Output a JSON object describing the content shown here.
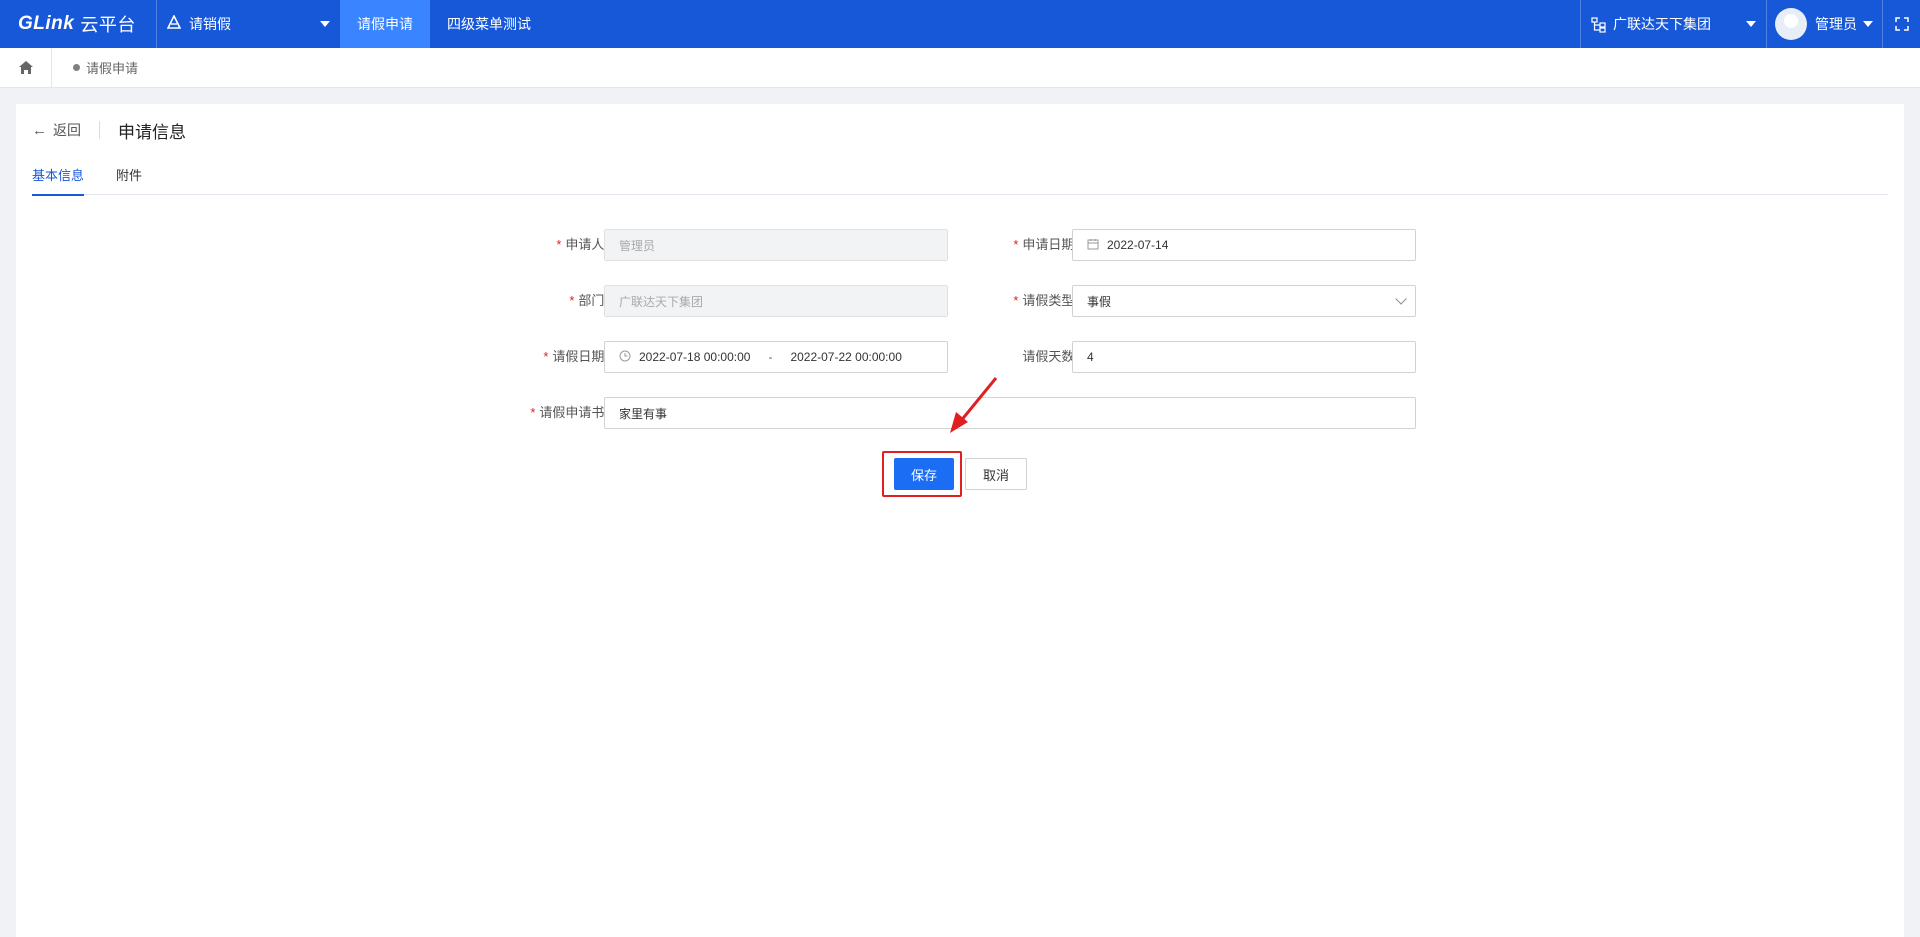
{
  "topbar": {
    "logo_text": "GLink",
    "logo_cn": "云平台",
    "app_name": "请销假",
    "menu": [
      {
        "label": "请假申请",
        "active": true
      },
      {
        "label": "四级菜单测试",
        "active": false
      }
    ],
    "org_name": "广联达天下集团",
    "user_name": "管理员"
  },
  "breadcrumb": {
    "current": "请假申请"
  },
  "header": {
    "back_label": "返回",
    "title": "申请信息"
  },
  "tabs": [
    {
      "label": "基本信息",
      "active": true
    },
    {
      "label": "附件",
      "active": false
    }
  ],
  "form": {
    "applicant": {
      "label": "申请人:",
      "value": "管理员",
      "required": true
    },
    "apply_date": {
      "label": "申请日期:",
      "value": "2022-07-14",
      "required": true
    },
    "department": {
      "label": "部门:",
      "value": "广联达天下集团",
      "required": true
    },
    "leave_type": {
      "label": "请假类型:",
      "value": "事假",
      "required": true
    },
    "leave_period": {
      "label": "请假日期:",
      "start": "2022-07-18 00:00:00",
      "separator": "-",
      "end": "2022-07-22 00:00:00",
      "required": true
    },
    "leave_days": {
      "label": "请假天数:",
      "value": "4",
      "required": false
    },
    "reason": {
      "label": "请假申请书:",
      "value": "家里有事",
      "required": true
    }
  },
  "actions": {
    "save_label": "保存",
    "cancel_label": "取消"
  },
  "colors": {
    "topbar": "#1758d9",
    "primary": "#1b6ef3",
    "annotation": "#e02020"
  }
}
